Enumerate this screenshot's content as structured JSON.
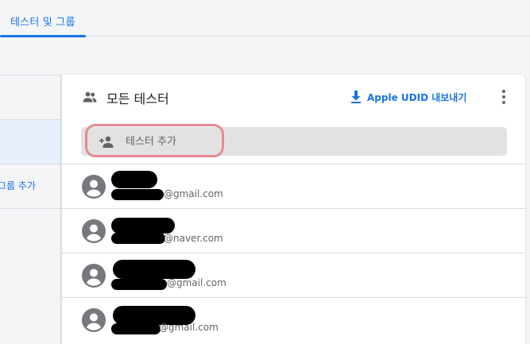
{
  "tabs": [
    {
      "label": "테스터 및 그룹",
      "active": true
    }
  ],
  "sidebar": {
    "add_group_label": "그룹 추가"
  },
  "panel": {
    "title": "모든 테스터",
    "export_label": "Apple UDID 내보내기",
    "search_placeholder": "테스터 추가"
  },
  "testers": [
    {
      "email_suffix": "@gmail.com"
    },
    {
      "email_suffix": "@naver.com"
    },
    {
      "email_suffix": "@gmail.com"
    },
    {
      "email_suffix": "@gmail.com"
    }
  ],
  "icons": {
    "header": "people-icon",
    "export": "download-icon",
    "menu": "more-vert-icon",
    "search": "person-add-icon",
    "avatar": "account-circle-icon"
  },
  "colors": {
    "accent": "#1a73e8",
    "highlight": "#e58a94",
    "background": "#f4f5f7",
    "search_bg": "#e2e2e2"
  }
}
